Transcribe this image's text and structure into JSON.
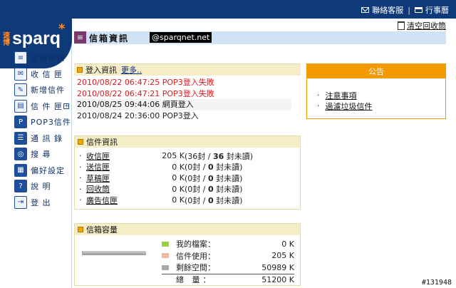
{
  "top_links": {
    "contact_label": "聯絡客服",
    "separator": "|",
    "calendar_label": "行事曆"
  },
  "logo": {
    "cn_text": "速博",
    "word": "sparq",
    "star": "*"
  },
  "sidebar": {
    "items": [
      {
        "icon": "📄",
        "label": "信箱資訊"
      },
      {
        "icon": "✉",
        "label": "收 信 匣"
      },
      {
        "icon": "✎",
        "label": "新增信件"
      },
      {
        "icon": "📁",
        "label": "信 件 匣"
      },
      {
        "icon": "P",
        "label": "POP3信件"
      },
      {
        "icon": "☰",
        "label": "通 訊 錄"
      },
      {
        "icon": "🔍",
        "label": "搜    尋"
      },
      {
        "icon": "⚙",
        "label": "偏好設定"
      },
      {
        "icon": "?",
        "label": "說    明"
      },
      {
        "icon": "⇥",
        "label": "登    出"
      }
    ],
    "expand_marker": "+"
  },
  "header": {
    "title": "信箱資訊",
    "email": "@sparqnet.net",
    "empty_trash_label": "清空回收筒"
  },
  "login_panel": {
    "title": "登入資訊",
    "more_label": "更多..",
    "rows": [
      {
        "text": "2010/08/22 06:47:25 POP3登入失敗",
        "status": "fail"
      },
      {
        "text": "2010/08/22 06:47:21 POP3登入失敗",
        "status": "fail"
      },
      {
        "text": "2010/08/25 09:44:06 網頁登入",
        "status": "ok"
      },
      {
        "text": "2010/08/24 20:36:00 POP3登入",
        "status": "normal"
      }
    ]
  },
  "notice_panel": {
    "title": "公告",
    "items": [
      "注意事項",
      "過濾垃圾信件"
    ]
  },
  "mail_panel": {
    "title": "信件資訊",
    "rows": [
      {
        "name": "收信匣",
        "size": "205 K",
        "pre": "(36封 / ",
        "bold": "36",
        "post": " 封未讀)"
      },
      {
        "name": "送信匣",
        "size": "0 K",
        "pre": "(0封 / ",
        "bold": "0",
        "post": " 封未讀)"
      },
      {
        "name": "草稿匣",
        "size": "0 K",
        "pre": "(0封 / ",
        "bold": "0",
        "post": " 封未讀)"
      },
      {
        "name": "回收筒",
        "size": "0 K",
        "pre": "(0封 / ",
        "bold": "0",
        "post": " 封未讀)"
      },
      {
        "name": "廣告信匣",
        "size": "0 K",
        "pre": "(0封 / ",
        "bold": "0",
        "post": " 封未讀)"
      }
    ]
  },
  "quota_panel": {
    "title": "信箱容量",
    "used_fraction": 0.004,
    "rows": [
      {
        "label": "我的檔案：",
        "value": "0 K",
        "color": "#9bcf4a"
      },
      {
        "label": "信件使用：",
        "value": "205 K",
        "color": "#f0b9a5"
      },
      {
        "label": "剩餘空間：",
        "value": "50989 K",
        "color": "#a9a9a9"
      }
    ],
    "total_label": "總    量：",
    "total_value": "51200 K"
  },
  "watermark": "#131948"
}
